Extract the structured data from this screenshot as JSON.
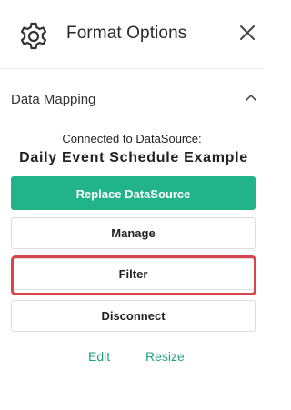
{
  "header": {
    "title": "Format Options",
    "settings_icon": "gear-icon",
    "close_icon": "close-icon"
  },
  "section": {
    "title": "Data Mapping",
    "toggle_icon": "chevron-up-icon",
    "connected_label": "Connected to DataSource:",
    "datasource_name": "Daily Event Schedule Example"
  },
  "buttons": {
    "replace": "Replace DataSource",
    "manage": "Manage",
    "filter": "Filter",
    "disconnect": "Disconnect"
  },
  "links": {
    "edit": "Edit",
    "resize": "Resize"
  },
  "colors": {
    "accent": "#21b48a",
    "link": "#21a084",
    "highlight": "#d9434b"
  }
}
